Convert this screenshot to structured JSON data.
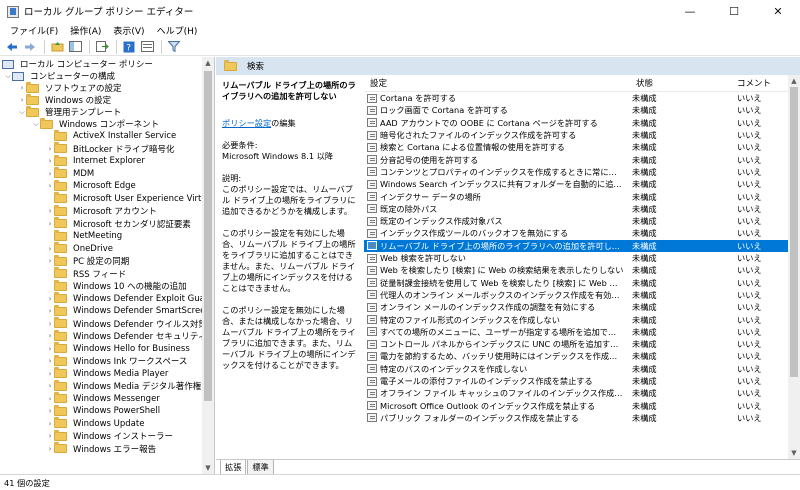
{
  "window": {
    "title": "ローカル グループ ポリシー エディター",
    "minimize": "—",
    "maximize": "☐",
    "close": "✕"
  },
  "menu": [
    "ファイル(F)",
    "操作(A)",
    "表示(V)",
    "ヘルプ(H)"
  ],
  "tree": {
    "root": "ローカル コンピューター ポリシー",
    "computer_config": "コンピューターの構成",
    "software_settings": "ソフトウェアの設定",
    "windows_settings": "Windows の設定",
    "admin_templates": "管理用テンプレート",
    "windows_components": "Windows コンポーネント",
    "children": [
      "ActiveX Installer Service",
      "BitLocker ドライブ暗号化",
      "Internet Explorer",
      "MDM",
      "Microsoft Edge",
      "Microsoft User Experience Virtualiz",
      "Microsoft アカウント",
      "Microsoft セカンダリ認証要素",
      "NetMeeting",
      "OneDrive",
      "PC 設定の同期",
      "RSS フィード",
      "Windows 10 への機能の追加",
      "Windows Defender Exploit Guard",
      "Windows Defender SmartScreen",
      "Windows Defender ウイルス対策",
      "Windows Defender セキュリティ センタ",
      "Windows Hello for Business",
      "Windows Ink ワークスペース",
      "Windows Media Player",
      "Windows Media デジタル著作権管理",
      "Windows Messenger",
      "Windows PowerShell",
      "Windows Update",
      "Windows インストーラー",
      "Windows エラー報告"
    ]
  },
  "category_title": "検索",
  "description": {
    "policy_title": "リムーバブル ドライブ上の場所のライブラリへの追加を許可しない",
    "edit_link": "ポリシー設定",
    "edit_suffix": "の編集",
    "requirements_label": "必要条件:",
    "requirements": "Microsoft Windows 8.1 以降",
    "explain_label": "説明:",
    "p1": "このポリシー設定では、リムーバブル ドライブ上の場所をライブラリに追加できるかどうかを構成します。",
    "p2": "このポリシー設定を有効にした場合、リムーバブル ドライブ上の場所をライブラリに追加することはできません。また、リムーバブル ドライブ上の場所にインデックスを付けることはできません。",
    "p3": "このポリシー設定を無効にした場合、または構成しなかった場合、リムーバブル ドライブ上の場所をライブラリに追加できます。また、リムーバブル ドライブ上の場所にインデックスを付けることができます。"
  },
  "list": {
    "headers": {
      "setting": "設定",
      "state": "状態",
      "comment": "コメント"
    },
    "selected_index": 14,
    "rows": [
      {
        "name": "Cortana を許可する",
        "state": "未構成",
        "comment": "いいえ"
      },
      {
        "name": "ロック画面で Cortana を許可する",
        "state": "未構成",
        "comment": "いいえ"
      },
      {
        "name": "AAD アカウントでの OOBE に Cortana ページを許可する",
        "state": "未構成",
        "comment": "いいえ"
      },
      {
        "name": "暗号化されたファイルのインデックス作成を許可する",
        "state": "未構成",
        "comment": "いいえ"
      },
      {
        "name": "検索と Cortana による位置情報の使用を許可する",
        "state": "未構成",
        "comment": "いいえ"
      },
      {
        "name": "分音記号の使用を許可する",
        "state": "未構成",
        "comment": "いいえ"
      },
      {
        "name": "コンテンツとプロパティのインデックスを作成するときに常に自動言語...",
        "state": "未構成",
        "comment": "いいえ"
      },
      {
        "name": "Windows Search インデックスに共有フォルダーを自動的に追加でき...",
        "state": "未構成",
        "comment": "いいえ"
      },
      {
        "name": "インデクサー データの場所",
        "state": "未構成",
        "comment": "いいえ"
      },
      {
        "name": "既定の除外パス",
        "state": "未構成",
        "comment": "いいえ"
      },
      {
        "name": "既定のインデックス作成対象パス",
        "state": "未構成",
        "comment": "いいえ"
      },
      {
        "name": "インデックス作成ツールのバックオフを無効にする",
        "state": "未構成",
        "comment": "いいえ"
      },
      {
        "name": "リムーバブル ドライブ上の場所のライブラリへの追加を許可しない",
        "state": "未構成",
        "comment": "いいえ"
      },
      {
        "name": "Web 検索を許可しない",
        "state": "未構成",
        "comment": "いいえ"
      },
      {
        "name": "Web を検索したり [検索] に Web の検索結果を表示したりしない",
        "state": "未構成",
        "comment": "いいえ"
      },
      {
        "name": "従量制課金接続を使用して Web を検索したり [検索] に Web の...",
        "state": "未構成",
        "comment": "いいえ"
      },
      {
        "name": "代理人のオンライン メールボックスのインデックス作成を有効にする",
        "state": "未構成",
        "comment": "いいえ"
      },
      {
        "name": "オンライン メールのインデックス作成の調整を有効にする",
        "state": "未構成",
        "comment": "いいえ"
      },
      {
        "name": "特定のファイル形式のインデックスを作成しない",
        "state": "未構成",
        "comment": "いいえ"
      },
      {
        "name": "すべての場所のメニューに、ユーザーが指定する場所を追加できないよ...",
        "state": "未構成",
        "comment": "いいえ"
      },
      {
        "name": "コントロール パネルからインデックスに UNC の場所を追加することを...",
        "state": "未構成",
        "comment": "いいえ"
      },
      {
        "name": "電力を節約するため、バッテリ使用時にはインデックスを作成しない",
        "state": "未構成",
        "comment": "いいえ"
      },
      {
        "name": "特定のパスのインデックスを作成しない",
        "state": "未構成",
        "comment": "いいえ"
      },
      {
        "name": "電子メールの添付ファイルのインデックス作成を禁止する",
        "state": "未構成",
        "comment": "いいえ"
      },
      {
        "name": "オフライン ファイル キャッシュのファイルのインデックス作成を禁止する",
        "state": "未構成",
        "comment": "いいえ"
      },
      {
        "name": "Microsoft Office Outlook のインデックス作成を禁止する",
        "state": "未構成",
        "comment": "いいえ"
      },
      {
        "name": "パブリック フォルダーのインデックス作成を禁止する",
        "state": "未構成",
        "comment": "いいえ"
      }
    ]
  },
  "tabs": [
    "拡張",
    "標準"
  ],
  "status": "41 個の設定"
}
